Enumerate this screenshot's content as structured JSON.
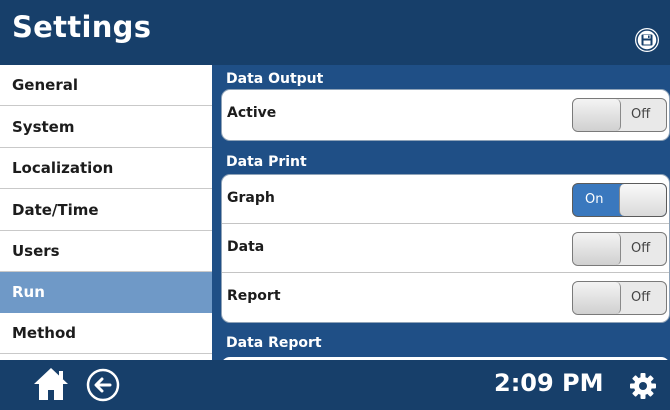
{
  "header": {
    "title": "Settings",
    "save_icon": "save-icon"
  },
  "sidebar": {
    "items": [
      {
        "label": "General",
        "active": false
      },
      {
        "label": "System",
        "active": false
      },
      {
        "label": "Localization",
        "active": false
      },
      {
        "label": "Date/Time",
        "active": false
      },
      {
        "label": "Users",
        "active": false
      },
      {
        "label": "Run",
        "active": true
      },
      {
        "label": "Method",
        "active": false
      }
    ],
    "active_color": "#6f99c7"
  },
  "content": {
    "sections": [
      {
        "title": "Data Output",
        "rows": [
          {
            "label": "Active",
            "state": "Off"
          }
        ]
      },
      {
        "title": "Data Print",
        "rows": [
          {
            "label": "Graph",
            "state": "On"
          },
          {
            "label": "Data",
            "state": "Off"
          },
          {
            "label": "Report",
            "state": "Off"
          }
        ]
      },
      {
        "title": "Data Report",
        "rows": []
      }
    ]
  },
  "footer": {
    "time": "2:09 PM",
    "home_icon": "home-icon",
    "back_icon": "back-arrow-icon",
    "settings_icon": "gear-icon"
  },
  "colors": {
    "header_bg": "#173f6a",
    "panel_bg": "#1f4f86",
    "toggle_on": "#3a78be"
  }
}
